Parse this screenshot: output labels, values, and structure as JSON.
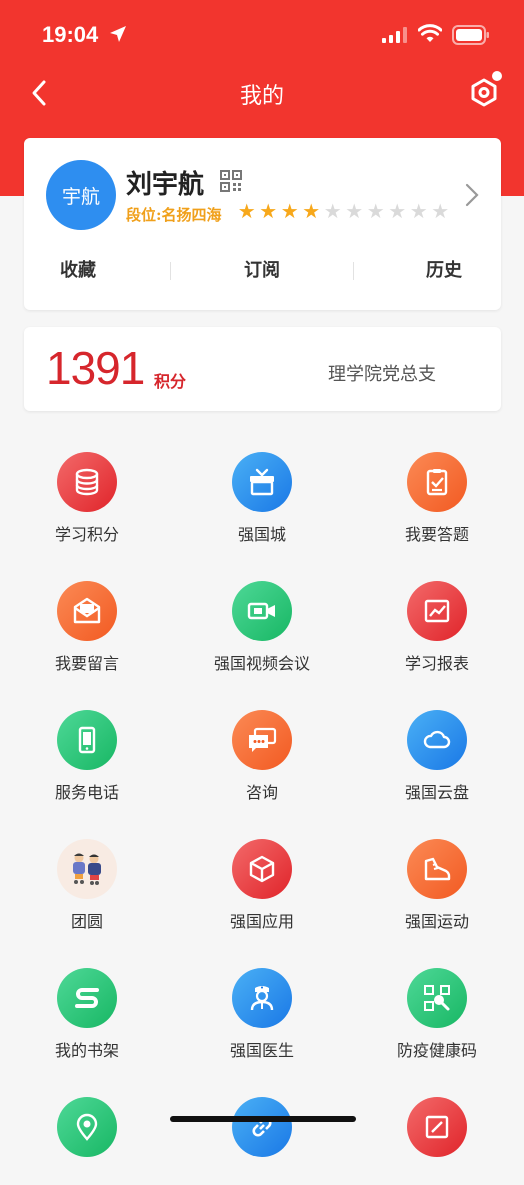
{
  "status_bar": {
    "time": "19:04"
  },
  "nav": {
    "title": "我的"
  },
  "profile": {
    "avatar_text": "宇航",
    "name": "刘宇航",
    "rank": "段位:名扬四海",
    "stars_filled": 4,
    "stars_total": 10,
    "tabs": [
      "收藏",
      "订阅",
      "历史"
    ]
  },
  "points": {
    "value": "1391",
    "unit": "积分",
    "org": "理学院党总支"
  },
  "colors": {
    "brand_red": "#f2352e",
    "points_red": "#d6262c",
    "rank_gold": "#f0a01b"
  },
  "grid": [
    {
      "label": "学习积分",
      "icon": "database-icon"
    },
    {
      "label": "强国城",
      "icon": "gift-box-icon"
    },
    {
      "label": "我要答题",
      "icon": "clipboard-check-icon"
    },
    {
      "label": "我要留言",
      "icon": "mail-open-icon"
    },
    {
      "label": "强国视频会议",
      "icon": "video-camera-icon"
    },
    {
      "label": "学习报表",
      "icon": "line-chart-icon"
    },
    {
      "label": "服务电话",
      "icon": "phone-icon"
    },
    {
      "label": "咨询",
      "icon": "chat-bubbles-icon"
    },
    {
      "label": "强国云盘",
      "icon": "cloud-icon"
    },
    {
      "label": "团圆",
      "icon": "family-reunion-icon"
    },
    {
      "label": "强国应用",
      "icon": "cube-icon"
    },
    {
      "label": "强国运动",
      "icon": "sneaker-icon"
    },
    {
      "label": "我的书架",
      "icon": "bookshelf-icon"
    },
    {
      "label": "强国医生",
      "icon": "doctor-icon"
    },
    {
      "label": "防疫健康码",
      "icon": "health-code-icon"
    },
    {
      "label": "",
      "icon": "location-pin-icon"
    },
    {
      "label": "",
      "icon": "link-icon"
    },
    {
      "label": "",
      "icon": "edit-note-icon"
    }
  ]
}
